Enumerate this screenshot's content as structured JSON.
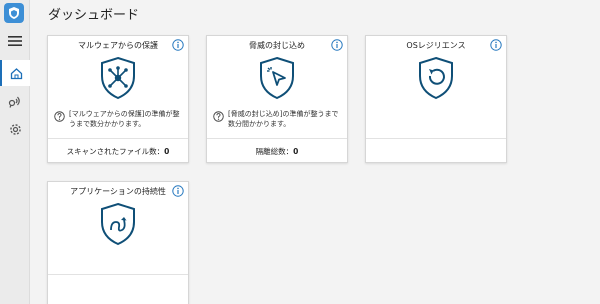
{
  "page": {
    "title": "ダッシュボード"
  },
  "colors": {
    "accent": "#1d6fb8",
    "icon": "#0f4f77",
    "info": "#2b7bc0"
  },
  "sidebar": {
    "items": [
      {
        "icon": "hamburger-icon"
      },
      {
        "icon": "home-icon",
        "active": true
      },
      {
        "icon": "broadcast-icon"
      },
      {
        "icon": "gear-icon"
      }
    ]
  },
  "cards": [
    {
      "title": "マルウェアからの保護",
      "icon": "network-shield-icon",
      "message": "[マルウェアからの保護]の準備が整うまで数分かかります。",
      "stat_label": "スキャンされたファイル数：",
      "stat_value": "0"
    },
    {
      "title": "脅威の封じ込め",
      "icon": "cursor-shield-icon",
      "message": "[脅威の封じ込め]の準備が整うまで数分間かかります。",
      "stat_label": "隔離総数：",
      "stat_value": "0"
    },
    {
      "title": "OSレジリエンス",
      "icon": "undo-shield-icon"
    },
    {
      "title": "アプリケーションの持続性",
      "icon": "loop-shield-icon"
    }
  ]
}
